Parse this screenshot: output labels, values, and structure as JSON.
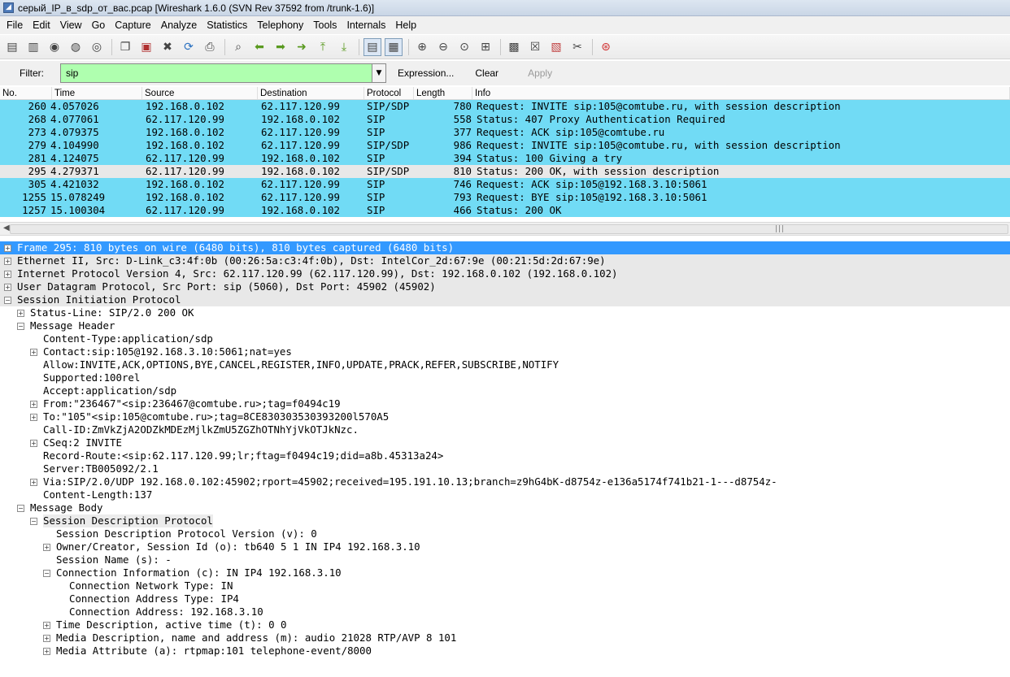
{
  "window": {
    "title": "серый_IP_в_sdp_от_вас.pcap   [Wireshark 1.6.0  (SVN Rev 37592 from /trunk-1.6)]"
  },
  "menu": [
    "File",
    "Edit",
    "View",
    "Go",
    "Capture",
    "Analyze",
    "Statistics",
    "Telephony",
    "Tools",
    "Internals",
    "Help"
  ],
  "toolbar": {
    "icons": [
      "interface-list-icon",
      "capture-options-icon",
      "start-capture-icon",
      "stop-capture-icon",
      "restart-capture-icon",
      "open-file-icon",
      "save-file-icon",
      "close-file-icon",
      "reload-icon",
      "print-icon",
      "find-packet-icon",
      "go-back-icon",
      "go-forward-icon",
      "go-to-packet-icon",
      "go-first-icon",
      "go-last-icon",
      "colorize-icon",
      "auto-scroll-icon",
      "zoom-in-icon",
      "zoom-out-icon",
      "normal-size-icon",
      "resize-columns-icon",
      "capture-filters-icon",
      "display-filters-icon",
      "coloring-rules-icon",
      "preferences-icon",
      "help-icon"
    ]
  },
  "filter": {
    "label": "Filter:",
    "value": "sip",
    "expression_label": "Expression...",
    "clear_label": "Clear",
    "apply_label": "Apply",
    "valid_color": "#afffaf"
  },
  "packet_list": {
    "columns": [
      "No.",
      "Time",
      "Source",
      "Destination",
      "Protocol",
      "Length",
      "Info"
    ],
    "rows": [
      {
        "no": "260",
        "time": "4.057026",
        "src": "192.168.0.102",
        "dst": "62.117.120.99",
        "proto": "SIP/SDP",
        "len": "780",
        "info": "Request: INVITE sip:105@comtube.ru, with session description",
        "bg": "#71dbf5"
      },
      {
        "no": "268",
        "time": "4.077061",
        "src": "62.117.120.99",
        "dst": "192.168.0.102",
        "proto": "SIP",
        "len": "558",
        "info": "Status: 407 Proxy Authentication Required",
        "bg": "#71dbf5"
      },
      {
        "no": "273",
        "time": "4.079375",
        "src": "192.168.0.102",
        "dst": "62.117.120.99",
        "proto": "SIP",
        "len": "377",
        "info": "Request: ACK sip:105@comtube.ru",
        "bg": "#71dbf5"
      },
      {
        "no": "279",
        "time": "4.104990",
        "src": "192.168.0.102",
        "dst": "62.117.120.99",
        "proto": "SIP/SDP",
        "len": "986",
        "info": "Request: INVITE sip:105@comtube.ru, with session description",
        "bg": "#71dbf5"
      },
      {
        "no": "281",
        "time": "4.124075",
        "src": "62.117.120.99",
        "dst": "192.168.0.102",
        "proto": "SIP",
        "len": "394",
        "info": "Status: 100 Giving a try",
        "bg": "#71dbf5"
      },
      {
        "no": "295",
        "time": "4.279371",
        "src": "62.117.120.99",
        "dst": "192.168.0.102",
        "proto": "SIP/SDP",
        "len": "810",
        "info": "Status: 200 OK, with session description",
        "bg": "#e8e8e8"
      },
      {
        "no": "305",
        "time": "4.421032",
        "src": "192.168.0.102",
        "dst": "62.117.120.99",
        "proto": "SIP",
        "len": "746",
        "info": "Request: ACK sip:105@192.168.3.10:5061",
        "bg": "#71dbf5"
      },
      {
        "no": "1255",
        "time": "15.078249",
        "src": "192.168.0.102",
        "dst": "62.117.120.99",
        "proto": "SIP",
        "len": "793",
        "info": "Request: BYE sip:105@192.168.3.10:5061",
        "bg": "#71dbf5"
      },
      {
        "no": "1257",
        "time": "15.100304",
        "src": "62.117.120.99",
        "dst": "192.168.0.102",
        "proto": "SIP",
        "len": "466",
        "info": "Status: 200 OK",
        "bg": "#71dbf5"
      }
    ]
  },
  "detail_tree": [
    {
      "level": 0,
      "exp": "+",
      "text": "Frame 295: 810 bytes on wire (6480 bits), 810 bytes captured (6480 bits)",
      "style": "sel"
    },
    {
      "level": 0,
      "exp": "+",
      "text": "Ethernet II, Src: D-Link_c3:4f:0b (00:26:5a:c3:4f:0b), Dst: IntelCor_2d:67:9e (00:21:5d:2d:67:9e)",
      "style": "grey"
    },
    {
      "level": 0,
      "exp": "+",
      "text": "Internet Protocol Version 4, Src: 62.117.120.99 (62.117.120.99), Dst: 192.168.0.102 (192.168.0.102)",
      "style": "grey"
    },
    {
      "level": 0,
      "exp": "+",
      "text": "User Datagram Protocol, Src Port: sip (5060), Dst Port: 45902 (45902)",
      "style": "grey"
    },
    {
      "level": 0,
      "exp": "-",
      "text": "Session Initiation Protocol",
      "style": "grey"
    },
    {
      "level": 1,
      "exp": "+",
      "text": "Status-Line: SIP/2.0 200 OK",
      "style": ""
    },
    {
      "level": 1,
      "exp": "-",
      "text": "Message Header",
      "style": ""
    },
    {
      "level": 2,
      "exp": "",
      "text": "Content-Type:application/sdp",
      "style": ""
    },
    {
      "level": 2,
      "exp": "+",
      "text": "Contact:sip:105@192.168.3.10:5061;nat=yes",
      "style": ""
    },
    {
      "level": 2,
      "exp": "",
      "text": "Allow:INVITE,ACK,OPTIONS,BYE,CANCEL,REGISTER,INFO,UPDATE,PRACK,REFER,SUBSCRIBE,NOTIFY",
      "style": ""
    },
    {
      "level": 2,
      "exp": "",
      "text": "Supported:100rel",
      "style": ""
    },
    {
      "level": 2,
      "exp": "",
      "text": "Accept:application/sdp",
      "style": ""
    },
    {
      "level": 2,
      "exp": "+",
      "text": "From:\"236467\"<sip:236467@comtube.ru>;tag=f0494c19",
      "style": ""
    },
    {
      "level": 2,
      "exp": "+",
      "text": "To:\"105\"<sip:105@comtube.ru>;tag=8CE830303530393200l570A5",
      "style": ""
    },
    {
      "level": 2,
      "exp": "",
      "text": "Call-ID:ZmVkZjA2ODZkMDEzMjlkZmU5ZGZhOTNhYjVkOTJkNzc.",
      "style": ""
    },
    {
      "level": 2,
      "exp": "+",
      "text": "CSeq:2 INVITE",
      "style": ""
    },
    {
      "level": 2,
      "exp": "",
      "text": "Record-Route:<sip:62.117.120.99;lr;ftag=f0494c19;did=a8b.45313a24>",
      "style": ""
    },
    {
      "level": 2,
      "exp": "",
      "text": "Server:TB005092/2.1",
      "style": ""
    },
    {
      "level": 2,
      "exp": "+",
      "text": "Via:SIP/2.0/UDP 192.168.0.102:45902;rport=45902;received=195.191.10.13;branch=z9hG4bK-d8754z-e136a5174f741b21-1---d8754z-",
      "style": ""
    },
    {
      "level": 2,
      "exp": "",
      "text": "Content-Length:137",
      "style": ""
    },
    {
      "level": 1,
      "exp": "-",
      "text": "Message Body",
      "style": ""
    },
    {
      "level": 2,
      "exp": "-",
      "text": "Session Description Protocol",
      "style": "subsel"
    },
    {
      "level": 3,
      "exp": "",
      "text": "Session Description Protocol Version (v): 0",
      "style": ""
    },
    {
      "level": 3,
      "exp": "+",
      "text": "Owner/Creator, Session Id (o): tb640 5 1 IN IP4 192.168.3.10",
      "style": ""
    },
    {
      "level": 3,
      "exp": "",
      "text": "Session Name (s): -",
      "style": ""
    },
    {
      "level": 3,
      "exp": "-",
      "text": "Connection Information (c): IN IP4 192.168.3.10",
      "style": ""
    },
    {
      "level": 4,
      "exp": "",
      "text": "Connection Network Type: IN",
      "style": ""
    },
    {
      "level": 4,
      "exp": "",
      "text": "Connection Address Type: IP4",
      "style": ""
    },
    {
      "level": 4,
      "exp": "",
      "text": "Connection Address: 192.168.3.10",
      "style": ""
    },
    {
      "level": 3,
      "exp": "+",
      "text": "Time Description, active time (t): 0 0",
      "style": ""
    },
    {
      "level": 3,
      "exp": "+",
      "text": "Media Description, name and address (m): audio 21028 RTP/AVP 8 101",
      "style": ""
    },
    {
      "level": 3,
      "exp": "+",
      "text": "Media Attribute (a): rtpmap:101 telephone-event/8000",
      "style": ""
    }
  ]
}
